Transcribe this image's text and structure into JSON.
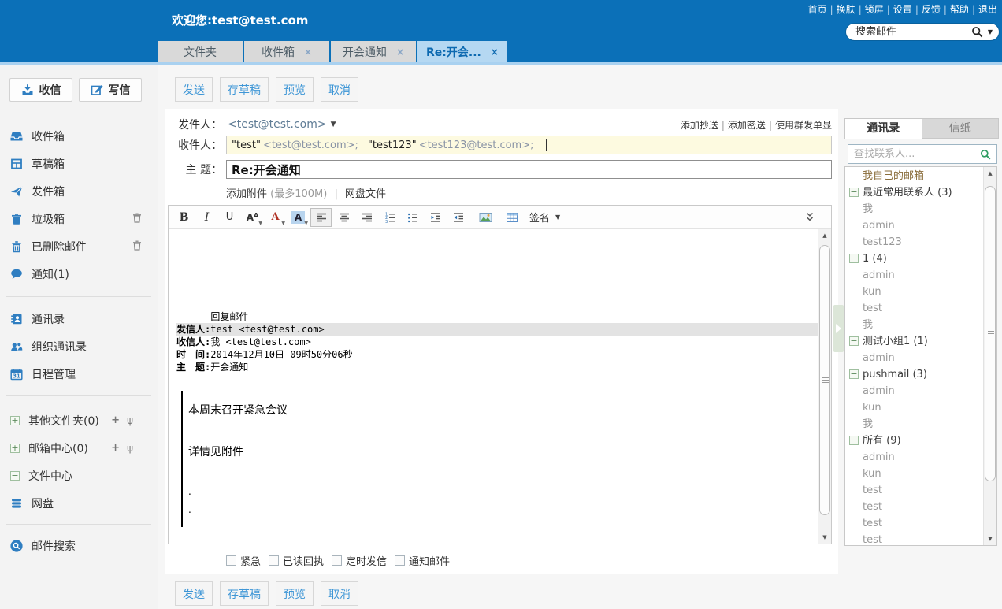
{
  "header": {
    "welcome": "欢迎您:test@test.com",
    "nav": [
      "首页",
      "换肤",
      "锁屏",
      "设置",
      "反馈",
      "帮助",
      "退出"
    ],
    "search_placeholder": "搜索邮件"
  },
  "tabs": {
    "items": [
      {
        "label": "文件夹"
      },
      {
        "label": "收件箱"
      },
      {
        "label": "开会通知"
      },
      {
        "label": "Re:开会..."
      }
    ],
    "close_glyph": "×"
  },
  "sidebar": {
    "receive_btn": "收信",
    "compose_btn": "写信",
    "folders": [
      "收件箱",
      "草稿箱",
      "发件箱",
      "垃圾箱",
      "已删除邮件",
      "通知(1)"
    ],
    "tools": [
      "通讯录",
      "组织通讯录",
      "日程管理"
    ],
    "extras": [
      "其他文件夹(0)",
      "邮箱中心(0)",
      "文件中心",
      "网盘"
    ],
    "mail_search": "邮件搜索"
  },
  "compose": {
    "actions": [
      "发送",
      "存草稿",
      "预览",
      "取消"
    ],
    "from_label": "发件人：",
    "from_value": "<test@test.com>",
    "header_links": [
      "添加抄送",
      "添加密送",
      "使用群发单显"
    ],
    "to_label": "收件人：",
    "recipients": [
      {
        "name": "\"test\"",
        "email": "<test@test.com>;"
      },
      {
        "name": "\"test123\"",
        "email": "<test123@test.com>;"
      }
    ],
    "subject_label": "主 题：",
    "subject_value": "Re:开会通知",
    "attach_link": "添加附件",
    "attach_hint": "(最多100M)",
    "netdisk_link": "网盘文件",
    "signature_label": "签名",
    "reply": {
      "title": "----- 回复邮件 -----",
      "fields": [
        {
          "label": "发信人:",
          "value": "test <test@test.com>"
        },
        {
          "label": "收信人:",
          "value": "我 <test@test.com>"
        },
        {
          "label": "时　间:",
          "value": "2014年12月10日 09时50分06秒"
        },
        {
          "label": "主　题:",
          "value": "开会通知"
        }
      ],
      "quote_line1": "本周末召开紧急会议",
      "quote_line2": "详情见附件",
      "quote_dot1": ".",
      "quote_dot2": "."
    },
    "options": [
      "紧急",
      "已读回执",
      "定时发信",
      "通知邮件"
    ]
  },
  "contacts": {
    "tab_contacts": "通讯录",
    "tab_stationery": "信纸",
    "search_placeholder": "查找联系人...",
    "tree": [
      {
        "label": "我自己的邮箱",
        "type": "self"
      },
      {
        "label": "最近常用联系人 (3)",
        "type": "group"
      },
      {
        "label": "我",
        "type": "member"
      },
      {
        "label": "admin",
        "type": "member"
      },
      {
        "label": "test123",
        "type": "member"
      },
      {
        "label": "1 (4)",
        "type": "group"
      },
      {
        "label": "admin",
        "type": "member"
      },
      {
        "label": "kun",
        "type": "member"
      },
      {
        "label": "test",
        "type": "member"
      },
      {
        "label": "我",
        "type": "member"
      },
      {
        "label": "测试小组1 (1)",
        "type": "group"
      },
      {
        "label": "admin",
        "type": "member"
      },
      {
        "label": "pushmail (3)",
        "type": "group"
      },
      {
        "label": "admin",
        "type": "member"
      },
      {
        "label": "kun",
        "type": "member"
      },
      {
        "label": "我",
        "type": "member"
      },
      {
        "label": "所有 (9)",
        "type": "group"
      },
      {
        "label": "admin",
        "type": "member"
      },
      {
        "label": "kun",
        "type": "member"
      },
      {
        "label": "test",
        "type": "member"
      },
      {
        "label": "test",
        "type": "member"
      },
      {
        "label": "test",
        "type": "member"
      },
      {
        "label": "test",
        "type": "member"
      }
    ]
  },
  "colors": {
    "header_blue": "#0b70b8",
    "accent_blue": "#3e96d6",
    "active_tab_blue": "#b5d8f2",
    "to_field_yellow": "#fdfae0"
  }
}
